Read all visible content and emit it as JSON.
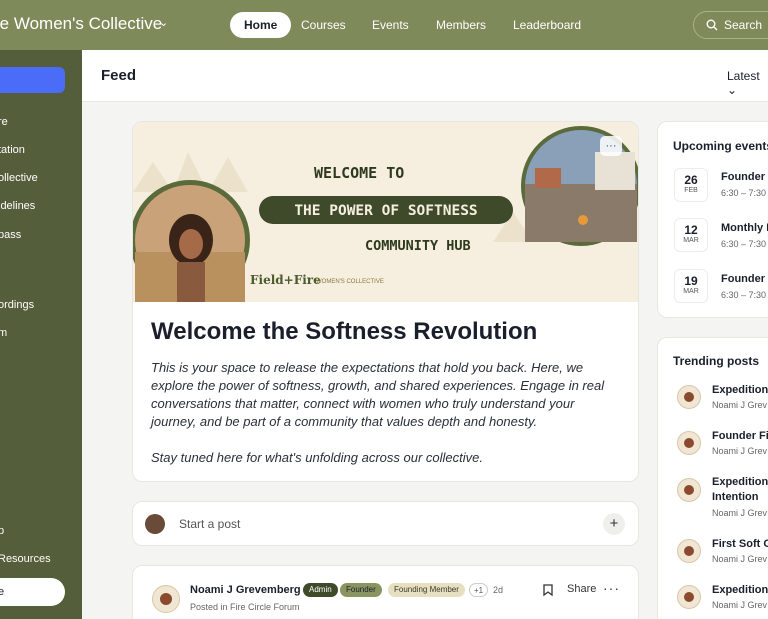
{
  "header": {
    "brand": "re Women's Collective",
    "nav": [
      "Home",
      "Courses",
      "Events",
      "Members",
      "Leaderboard"
    ],
    "search_label": "Search"
  },
  "sidebar": {
    "items": [
      "re",
      "tation",
      "ollective",
      "idelines",
      "pass",
      "ordings",
      "m",
      "p",
      "Resources"
    ],
    "bottom_button": "e"
  },
  "feed": {
    "title": "Feed",
    "sort": "Latest"
  },
  "hero": {
    "line1": "WELCOME TO",
    "line2": "THE POWER OF SOFTNESS",
    "line3": "COMMUNITY HUB",
    "logo": "Field+Fire",
    "logo_sub": "WOMEN'S COLLECTIVE"
  },
  "welcome": {
    "title": "Welcome the Softness Revolution",
    "para1": "This is your space to release the expectations that hold you back. Here, we explore the power of softness, growth, and shared experiences. Engage in real conversations that matter, connect with women who truly understand your journey, and be part of a community that values depth and honesty.",
    "para2": "Stay tuned here for what's unfolding across our collective."
  },
  "composer": {
    "placeholder": "Start a post"
  },
  "post": {
    "author": "Noami J Grevemberg",
    "badges": [
      "Admin",
      "Founder",
      "Founding Member"
    ],
    "extra": "+1",
    "age": "2d",
    "posted_in": "Posted in Fire Circle Forum",
    "share": "Share"
  },
  "events": {
    "title": "Upcoming events",
    "items": [
      {
        "day": "26",
        "month": "FEB",
        "name": "Founder F",
        "time": "6:30 – 7:30"
      },
      {
        "day": "12",
        "month": "MAR",
        "name": "Monthly F",
        "time": "6:30 – 7:30"
      },
      {
        "day": "19",
        "month": "MAR",
        "name": "Founder F",
        "time": "6:30 – 7:30"
      }
    ]
  },
  "trending": {
    "title": "Trending posts",
    "items": [
      {
        "title": "Expedition",
        "title2": "",
        "author": "Noami J Grev"
      },
      {
        "title": "Founder Fir",
        "title2": "",
        "author": "Noami J Grev"
      },
      {
        "title": "Expedition",
        "title2": "Intention",
        "author": "Noami J Grev"
      },
      {
        "title": "First Soft G",
        "title2": "",
        "author": "Noami J Grev"
      },
      {
        "title": "Expedition",
        "title2": "",
        "author": "Noami J Grev"
      }
    ]
  },
  "colors": {
    "topbar": "#7e8a5a",
    "sidebar": "#545e3a",
    "accent": "#4a6cf7"
  }
}
